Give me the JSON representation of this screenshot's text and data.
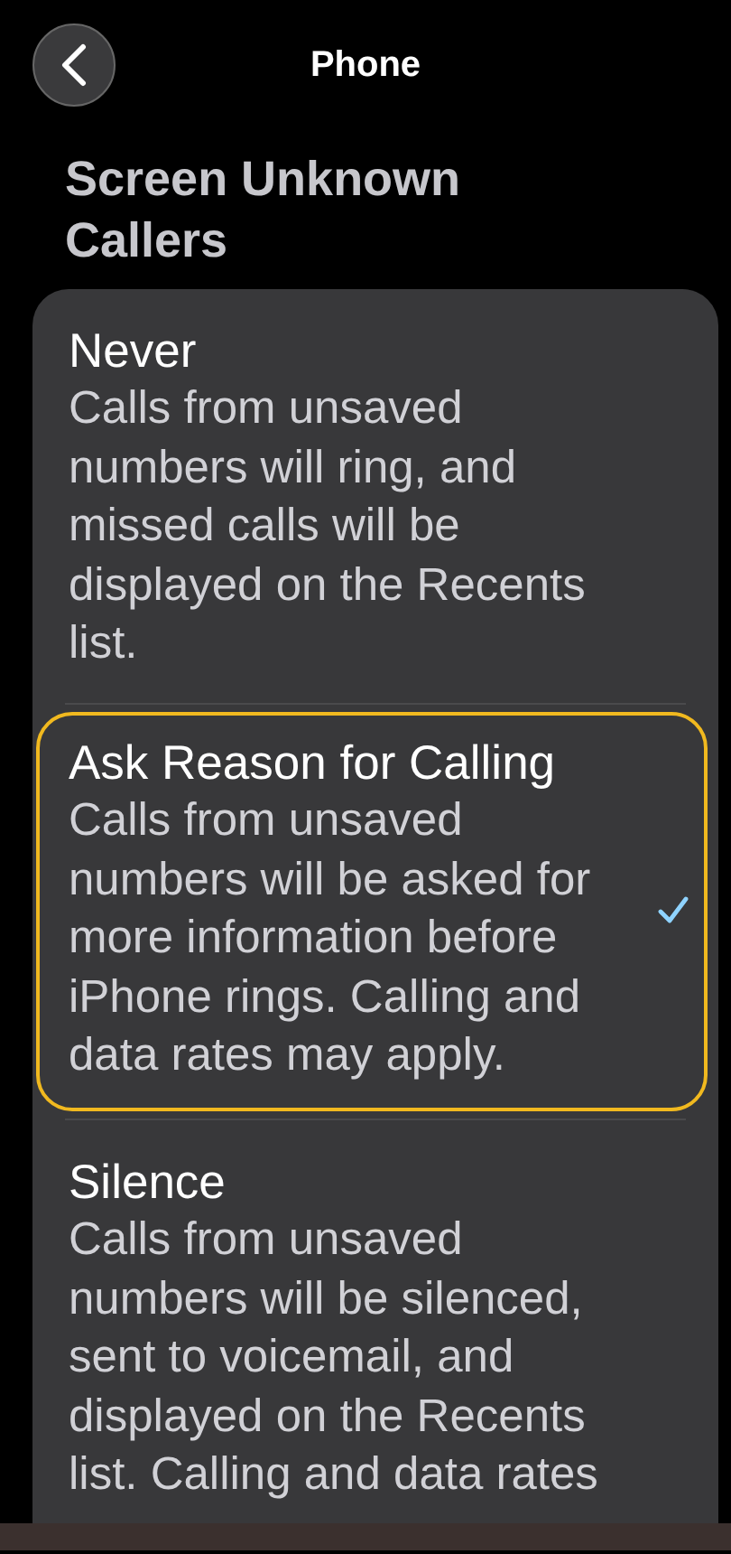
{
  "nav": {
    "title": "Phone"
  },
  "section_title": "Screen Unknown Callers",
  "options": [
    {
      "title": "Never",
      "description": "Calls from unsaved numbers will ring, and missed calls will be displayed on the Recents list.",
      "selected": false,
      "highlighted": false
    },
    {
      "title": "Ask Reason for Calling",
      "description": "Calls from unsaved numbers will be asked for more information before iPhone rings. Calling and data rates may apply.",
      "selected": true,
      "highlighted": true
    },
    {
      "title": "Silence",
      "description": "Calls from unsaved numbers will be silenced, sent to voicemail, and displayed on the Recents list. Calling and data rates",
      "selected": false,
      "highlighted": false
    }
  ]
}
